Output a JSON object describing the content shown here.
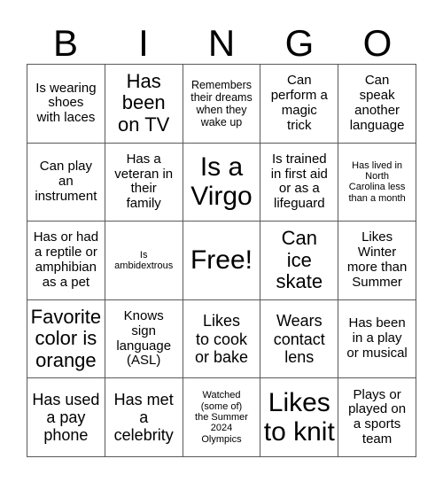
{
  "card": {
    "title": "BINGO",
    "header_letters": [
      "B",
      "I",
      "N",
      "G",
      "O"
    ],
    "columns": 5,
    "rows": 5,
    "free_space": {
      "row": 3,
      "column": 3,
      "label": "Free!"
    },
    "border_color": "#595959",
    "background_color": "#ffffff",
    "text_color": "#000000",
    "cells": [
      [
        {
          "text": "Is wearing\nshoes\nwith laces",
          "size": "md",
          "marked": false
        },
        {
          "text": "Has\nbeen\non TV",
          "size": "xl",
          "marked": false
        },
        {
          "text": "Remembers\ntheir dreams\nwhen they\nwake up",
          "size": "sm",
          "marked": false
        },
        {
          "text": "Can\nperform a\nmagic\ntrick",
          "size": "md",
          "marked": false
        },
        {
          "text": "Can\nspeak\nanother\nlanguage",
          "size": "md",
          "marked": false
        }
      ],
      [
        {
          "text": "Can play\nan\ninstrument",
          "size": "md",
          "marked": false
        },
        {
          "text": "Has a\nveteran in\ntheir\nfamily",
          "size": "md",
          "marked": false
        },
        {
          "text": "Is a\nVirgo",
          "size": "xxl",
          "marked": false
        },
        {
          "text": "Is trained\nin first aid\nor as a\nlifeguard",
          "size": "md",
          "marked": false
        },
        {
          "text": "Has lived in\nNorth\nCarolina less\nthan a month",
          "size": "xs",
          "marked": false
        }
      ],
      [
        {
          "text": "Has or had\na reptile or\namphibian\nas a pet",
          "size": "md",
          "marked": false
        },
        {
          "text": "Is\nambidextrous",
          "size": "xs",
          "marked": false
        },
        {
          "text": "Free!",
          "size": "xxl",
          "marked": false
        },
        {
          "text": "Can\nice\nskate",
          "size": "xl",
          "marked": false
        },
        {
          "text": "Likes\nWinter\nmore than\nSummer",
          "size": "md",
          "marked": false
        }
      ],
      [
        {
          "text": "Favorite\ncolor is\norange",
          "size": "xl",
          "marked": false
        },
        {
          "text": "Knows\nsign\nlanguage\n(ASL)",
          "size": "md",
          "marked": false
        },
        {
          "text": "Likes\nto cook\nor bake",
          "size": "lg",
          "marked": false
        },
        {
          "text": "Wears\ncontact\nlens",
          "size": "lg",
          "marked": false
        },
        {
          "text": "Has been\nin a play\nor musical",
          "size": "md",
          "marked": false
        }
      ],
      [
        {
          "text": "Has used\na pay\nphone",
          "size": "lg",
          "marked": false
        },
        {
          "text": "Has met\na\ncelebrity",
          "size": "lg",
          "marked": false
        },
        {
          "text": "Watched\n(some of)\nthe Summer\n2024\nOlympics",
          "size": "xs",
          "marked": false
        },
        {
          "text": "Likes\nto knit",
          "size": "xxl",
          "marked": false
        },
        {
          "text": "Plays or\nplayed on\na sports\nteam",
          "size": "md",
          "marked": false
        }
      ]
    ]
  }
}
